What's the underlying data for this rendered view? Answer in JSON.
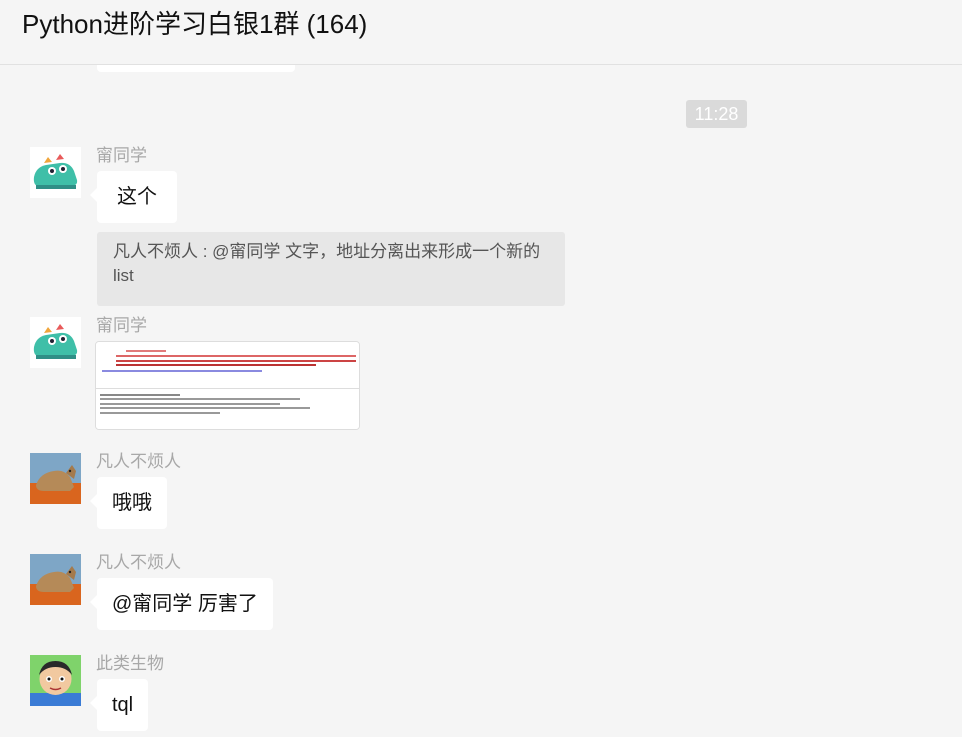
{
  "header": {
    "title": "Python进阶学习白银1群 (164)"
  },
  "chat": {
    "time": "11:28",
    "messages": [
      {
        "sender": "甯同学",
        "text": "这个"
      },
      {
        "quote": "凡人不烦人 : @甯同学 文字，地址分离出来形成一个新的list"
      },
      {
        "sender": "甯同学",
        "type": "image"
      },
      {
        "sender": "凡人不烦人",
        "text": "哦哦"
      },
      {
        "sender": "凡人不烦人",
        "text": "@甯同学 厉害了"
      },
      {
        "sender": "此类生物",
        "text": "tql"
      }
    ]
  },
  "colors": {
    "background": "#f5f5f5",
    "bubble": "#ffffff",
    "quote_bg": "#e7e7e7",
    "time_badge": "#dadada",
    "sender_text": "#a8a8a8"
  },
  "icons": [
    "shoe-avatar-icon",
    "wolf-avatar-icon",
    "cartoon-face-avatar-icon"
  ]
}
